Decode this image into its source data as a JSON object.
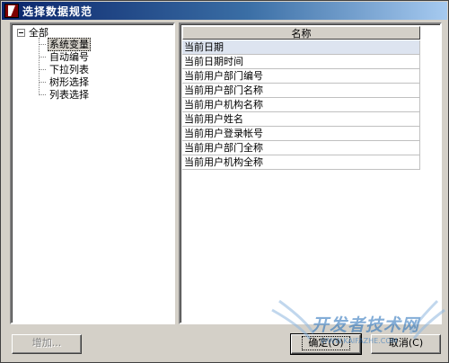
{
  "window": {
    "title": "选择数据规范"
  },
  "tree": {
    "root_label": "全部",
    "children": [
      "系统变量",
      "自动编号",
      "下拉列表",
      "树形选择",
      "列表选择"
    ],
    "selected_index": 0
  },
  "list": {
    "column_header": "名称",
    "rows": [
      "当前日期",
      "当前日期时间",
      "当前用户部门编号",
      "当前用户部门名称",
      "当前用户机构名称",
      "当前用户姓名",
      "当前用户登录帐号",
      "当前用户部门全称",
      "当前用户机构全称"
    ],
    "selected_index": 0
  },
  "buttons": {
    "add": "增加...",
    "ok": "确定(O)",
    "cancel": "取消(C)"
  },
  "watermark": {
    "text": "开发者技术网",
    "sub": "WWW.KAIFAZHE.COM"
  },
  "colors": {
    "titlebar_start": "#0a246a",
    "titlebar_end": "#a6caf0",
    "dialog_bg": "#d4d0c8",
    "selection": "#dde4f0"
  }
}
